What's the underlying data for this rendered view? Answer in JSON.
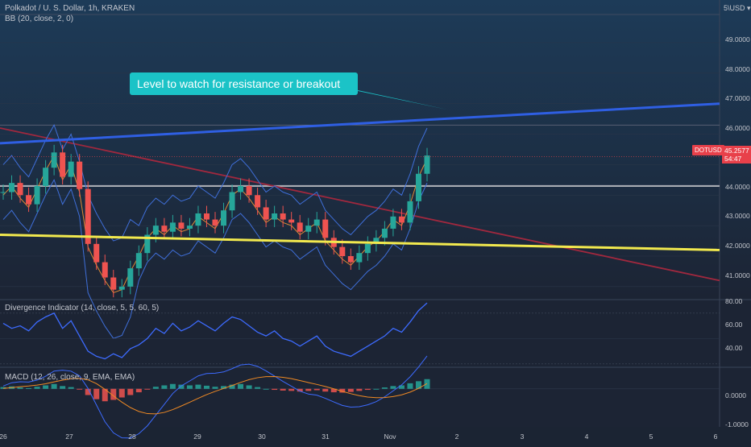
{
  "header": {
    "symbol_title": "Polkadot / U. S. Dollar, 1h, KRAKEN",
    "indicator_bb": "BB (20, close, 2, 0)",
    "currency_label": "USD",
    "currency_menu_glyph": "5\\"
  },
  "annotation": {
    "callout_text": "Level to watch for resistance or breakout"
  },
  "price_scale": {
    "labels": [
      "49.0000",
      "48.0000",
      "47.0000",
      "46.0000",
      "44.0000",
      "43.0000",
      "42.0000",
      "41.0000"
    ],
    "ticker": "DOTUSD",
    "last_price": "45.2577",
    "countdown": "54:47"
  },
  "divergence_panel": {
    "title": "Divergence Indicator (14, close, 5, 5, 60, 5)",
    "labels": [
      "80.00",
      "60.00",
      "40.00"
    ]
  },
  "macd_panel": {
    "title": "MACD (12, 26, close, 9, EMA, EMA)",
    "labels": [
      "0.0000",
      "-1.0000"
    ]
  },
  "time_axis": {
    "labels": [
      "26",
      "27",
      "28",
      "29",
      "30",
      "31",
      "Nov",
      "2",
      "3",
      "4",
      "5",
      "6"
    ]
  },
  "colors": {
    "background": "#1b2433",
    "resistance_line": "#2f5fe3",
    "support_line": "#f2e94e",
    "descending_line": "#a0283e",
    "horizontal_level": "#a9acb3",
    "bollinger_band": "#3f6fd9",
    "bollinger_basis": "#e08a34",
    "callout": "#1bc3c7",
    "candle_up": "#26a69a",
    "candle_down": "#ef5350",
    "rsi_line": "#3d6bff",
    "macd_line": "#3d6bff",
    "signal_line": "#f08a24"
  },
  "chart_data": {
    "type": "candlestick",
    "symbol": "DOTUSD",
    "timeframe": "1h",
    "exchange": "KRAKEN",
    "ylim": [
      40.6,
      50.4
    ],
    "last_price": 45.2577,
    "x_labels": [
      "26",
      "27",
      "28",
      "29",
      "30",
      "31",
      "Nov",
      "2",
      "3",
      "4",
      "5",
      "6"
    ],
    "close_path": [
      44.1,
      44.4,
      44.0,
      43.7,
      44.3,
      44.9,
      45.4,
      44.6,
      45.1,
      44.2,
      42.4,
      41.8,
      41.3,
      40.9,
      41.0,
      41.6,
      42.1,
      42.7,
      43.0,
      42.8,
      43.1,
      42.9,
      43.0,
      43.4,
      43.2,
      43.0,
      43.5,
      44.1,
      44.3,
      44.0,
      43.6,
      43.2,
      43.4,
      43.2,
      43.1,
      42.8,
      43.0,
      43.2,
      42.6,
      42.3,
      42.0,
      41.8,
      42.1,
      42.4,
      42.6,
      42.9,
      43.3,
      43.1,
      43.8,
      44.7,
      45.3
    ],
    "levels": {
      "horizontal_resistance": 44.3,
      "resistance_trendline_start": 45.7,
      "resistance_trendline_end": 47.0,
      "support_trendline_start": 42.7,
      "support_trendline_end": 42.2,
      "descending_trendline_start": 46.2,
      "descending_trendline_end": 41.2
    },
    "rsi_ylim": [
      28,
      80
    ],
    "rsi_path": [
      62,
      58,
      60,
      56,
      63,
      67,
      70,
      58,
      64,
      52,
      40,
      36,
      34,
      38,
      35,
      42,
      45,
      50,
      58,
      54,
      62,
      56,
      59,
      64,
      60,
      56,
      62,
      67,
      65,
      60,
      55,
      52,
      56,
      50,
      48,
      44,
      48,
      52,
      44,
      40,
      38,
      36,
      40,
      44,
      48,
      52,
      58,
      55,
      63,
      72,
      78
    ],
    "macd_ylim": [
      -1.1,
      0.6
    ],
    "macd_hist": [
      0.05,
      0.07,
      0.04,
      0.02,
      0.06,
      0.1,
      0.14,
      0.08,
      0.05,
      -0.02,
      -0.18,
      -0.3,
      -0.36,
      -0.32,
      -0.25,
      -0.18,
      -0.1,
      -0.02,
      0.06,
      0.1,
      0.14,
      0.12,
      0.1,
      0.12,
      0.09,
      0.06,
      0.08,
      0.12,
      0.14,
      0.1,
      0.05,
      0.0,
      -0.03,
      -0.05,
      -0.06,
      -0.08,
      -0.06,
      -0.04,
      -0.08,
      -0.1,
      -0.11,
      -0.09,
      -0.06,
      -0.03,
      0.0,
      0.04,
      0.08,
      0.1,
      0.16,
      0.22,
      0.28
    ]
  }
}
